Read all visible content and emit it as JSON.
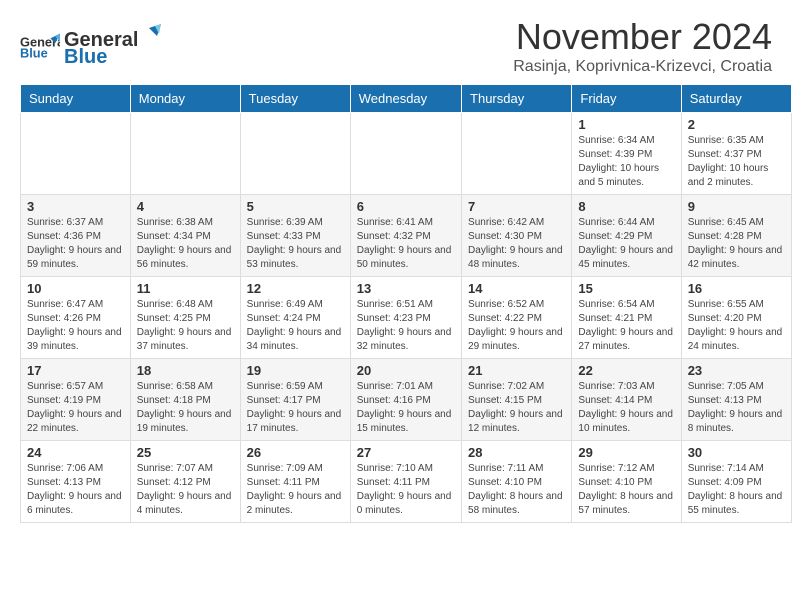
{
  "header": {
    "logo_general": "General",
    "logo_blue": "Blue",
    "month_title": "November 2024",
    "location": "Rasinja, Koprivnica-Krizevci, Croatia"
  },
  "calendar": {
    "headers": [
      "Sunday",
      "Monday",
      "Tuesday",
      "Wednesday",
      "Thursday",
      "Friday",
      "Saturday"
    ],
    "weeks": [
      [
        {
          "day": "",
          "info": ""
        },
        {
          "day": "",
          "info": ""
        },
        {
          "day": "",
          "info": ""
        },
        {
          "day": "",
          "info": ""
        },
        {
          "day": "",
          "info": ""
        },
        {
          "day": "1",
          "info": "Sunrise: 6:34 AM\nSunset: 4:39 PM\nDaylight: 10 hours and 5 minutes."
        },
        {
          "day": "2",
          "info": "Sunrise: 6:35 AM\nSunset: 4:37 PM\nDaylight: 10 hours and 2 minutes."
        }
      ],
      [
        {
          "day": "3",
          "info": "Sunrise: 6:37 AM\nSunset: 4:36 PM\nDaylight: 9 hours and 59 minutes."
        },
        {
          "day": "4",
          "info": "Sunrise: 6:38 AM\nSunset: 4:34 PM\nDaylight: 9 hours and 56 minutes."
        },
        {
          "day": "5",
          "info": "Sunrise: 6:39 AM\nSunset: 4:33 PM\nDaylight: 9 hours and 53 minutes."
        },
        {
          "day": "6",
          "info": "Sunrise: 6:41 AM\nSunset: 4:32 PM\nDaylight: 9 hours and 50 minutes."
        },
        {
          "day": "7",
          "info": "Sunrise: 6:42 AM\nSunset: 4:30 PM\nDaylight: 9 hours and 48 minutes."
        },
        {
          "day": "8",
          "info": "Sunrise: 6:44 AM\nSunset: 4:29 PM\nDaylight: 9 hours and 45 minutes."
        },
        {
          "day": "9",
          "info": "Sunrise: 6:45 AM\nSunset: 4:28 PM\nDaylight: 9 hours and 42 minutes."
        }
      ],
      [
        {
          "day": "10",
          "info": "Sunrise: 6:47 AM\nSunset: 4:26 PM\nDaylight: 9 hours and 39 minutes."
        },
        {
          "day": "11",
          "info": "Sunrise: 6:48 AM\nSunset: 4:25 PM\nDaylight: 9 hours and 37 minutes."
        },
        {
          "day": "12",
          "info": "Sunrise: 6:49 AM\nSunset: 4:24 PM\nDaylight: 9 hours and 34 minutes."
        },
        {
          "day": "13",
          "info": "Sunrise: 6:51 AM\nSunset: 4:23 PM\nDaylight: 9 hours and 32 minutes."
        },
        {
          "day": "14",
          "info": "Sunrise: 6:52 AM\nSunset: 4:22 PM\nDaylight: 9 hours and 29 minutes."
        },
        {
          "day": "15",
          "info": "Sunrise: 6:54 AM\nSunset: 4:21 PM\nDaylight: 9 hours and 27 minutes."
        },
        {
          "day": "16",
          "info": "Sunrise: 6:55 AM\nSunset: 4:20 PM\nDaylight: 9 hours and 24 minutes."
        }
      ],
      [
        {
          "day": "17",
          "info": "Sunrise: 6:57 AM\nSunset: 4:19 PM\nDaylight: 9 hours and 22 minutes."
        },
        {
          "day": "18",
          "info": "Sunrise: 6:58 AM\nSunset: 4:18 PM\nDaylight: 9 hours and 19 minutes."
        },
        {
          "day": "19",
          "info": "Sunrise: 6:59 AM\nSunset: 4:17 PM\nDaylight: 9 hours and 17 minutes."
        },
        {
          "day": "20",
          "info": "Sunrise: 7:01 AM\nSunset: 4:16 PM\nDaylight: 9 hours and 15 minutes."
        },
        {
          "day": "21",
          "info": "Sunrise: 7:02 AM\nSunset: 4:15 PM\nDaylight: 9 hours and 12 minutes."
        },
        {
          "day": "22",
          "info": "Sunrise: 7:03 AM\nSunset: 4:14 PM\nDaylight: 9 hours and 10 minutes."
        },
        {
          "day": "23",
          "info": "Sunrise: 7:05 AM\nSunset: 4:13 PM\nDaylight: 9 hours and 8 minutes."
        }
      ],
      [
        {
          "day": "24",
          "info": "Sunrise: 7:06 AM\nSunset: 4:13 PM\nDaylight: 9 hours and 6 minutes."
        },
        {
          "day": "25",
          "info": "Sunrise: 7:07 AM\nSunset: 4:12 PM\nDaylight: 9 hours and 4 minutes."
        },
        {
          "day": "26",
          "info": "Sunrise: 7:09 AM\nSunset: 4:11 PM\nDaylight: 9 hours and 2 minutes."
        },
        {
          "day": "27",
          "info": "Sunrise: 7:10 AM\nSunset: 4:11 PM\nDaylight: 9 hours and 0 minutes."
        },
        {
          "day": "28",
          "info": "Sunrise: 7:11 AM\nSunset: 4:10 PM\nDaylight: 8 hours and 58 minutes."
        },
        {
          "day": "29",
          "info": "Sunrise: 7:12 AM\nSunset: 4:10 PM\nDaylight: 8 hours and 57 minutes."
        },
        {
          "day": "30",
          "info": "Sunrise: 7:14 AM\nSunset: 4:09 PM\nDaylight: 8 hours and 55 minutes."
        }
      ]
    ]
  }
}
